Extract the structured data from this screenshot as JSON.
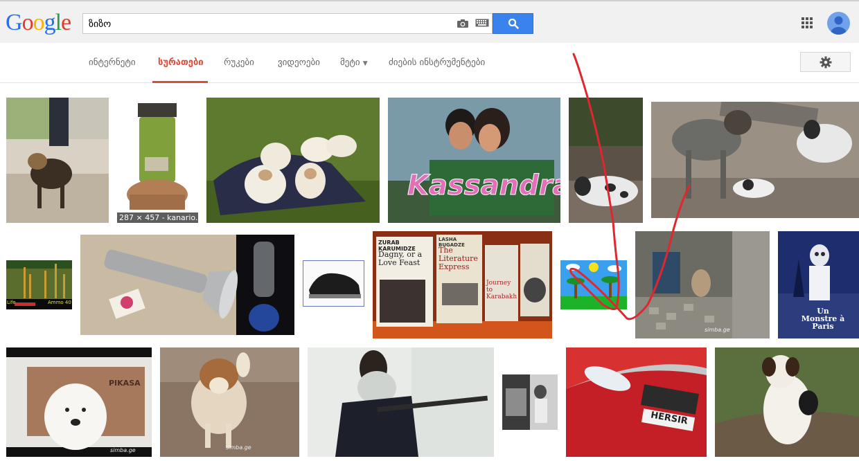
{
  "logo": {
    "letters": [
      "G",
      "o",
      "o",
      "g",
      "l",
      "e"
    ]
  },
  "search": {
    "query": "ზიზო"
  },
  "icons": {
    "camera": "camera-icon",
    "keyboard": "keyboard-icon",
    "search": "search-icon",
    "apps": "apps-grid-icon",
    "account": "account-avatar",
    "settings": "gear-icon"
  },
  "nav": {
    "tabs": [
      {
        "label": "ინტერნეტი"
      },
      {
        "label": "სურათები"
      },
      {
        "label": "რუკები"
      },
      {
        "label": "ვიდეოები"
      },
      {
        "label": "მეტი"
      },
      {
        "label": "ძიების ინსტრუმენტები"
      }
    ],
    "active_tab": "სურათები"
  },
  "results": {
    "row1": [
      {
        "name": "german-shepherd"
      },
      {
        "name": "green-kerosene-heater",
        "caption": "287 × 457 - kanario..."
      },
      {
        "name": "puppies-on-blanket"
      },
      {
        "name": "kassandra-tv-poster"
      },
      {
        "name": "black-white-dog"
      },
      {
        "name": "hunting-dogs"
      }
    ],
    "row2": [
      {
        "name": "game-screenshot",
        "hud_left": "Life",
        "hud_right": "Ammo 40"
      },
      {
        "name": "silver-flashlight"
      },
      {
        "name": "black-sneaker"
      },
      {
        "name": "books-on-shelf",
        "book1_author": "ZURAB KARUMIDZE",
        "book1_title": "Dagny, or a Love Feast",
        "book2_author": "LASHA BUGADZE",
        "book2_title": "The Literature Express",
        "book3_title": "Journey to Karabakh"
      },
      {
        "name": "palm-tree-cartoon"
      },
      {
        "name": "yard-dog",
        "watermark": "simba.ge"
      },
      {
        "name": "monster-in-paris-poster",
        "title": "Un Monstre à Paris"
      }
    ],
    "row3": [
      {
        "name": "white-dog-in-snow",
        "watermark": "simba.ge",
        "wall_text": "PIKASA"
      },
      {
        "name": "puppy-on-dirt",
        "watermark": "simba.ge"
      },
      {
        "name": "man-with-scarf"
      },
      {
        "name": "vintage-photo"
      },
      {
        "name": "red-honda-car",
        "plate": "HERSIR"
      },
      {
        "name": "jack-russell-terrier"
      }
    ]
  },
  "colors": {
    "accent": "#dd4b39",
    "search_button": "#3a83ee",
    "annotation": "#e0262e"
  }
}
